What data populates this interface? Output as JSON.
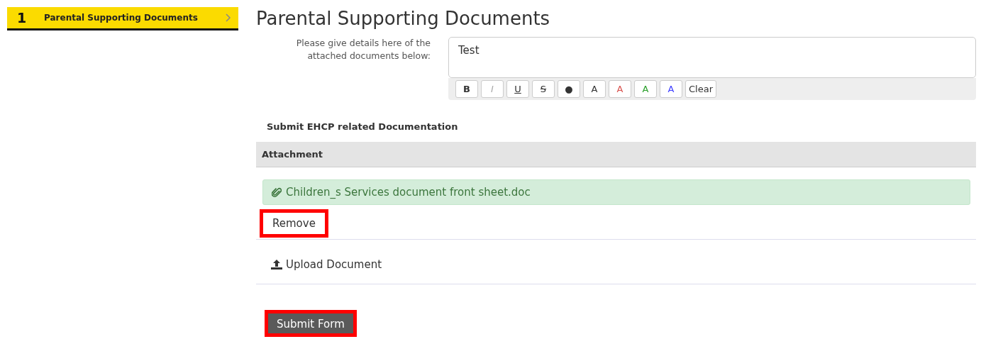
{
  "steps": [
    {
      "number": "1",
      "label": "Parental Supporting Documents",
      "selected": true
    }
  ],
  "heading": "Parental Supporting Documents",
  "details_field": {
    "label": "Please give details here of the attached documents below:",
    "value": "Test"
  },
  "toolbar": [
    {
      "label": "B",
      "kind": "bold"
    },
    {
      "label": "I",
      "kind": "italic"
    },
    {
      "label": "U",
      "kind": "underline"
    },
    {
      "label": "S",
      "kind": "strike"
    },
    {
      "label": "●",
      "kind": "plain"
    },
    {
      "label": "A",
      "kind": "color",
      "color": "#333333"
    },
    {
      "label": "A",
      "kind": "color",
      "color": "#d9534f"
    },
    {
      "label": "A",
      "kind": "color",
      "color": "#2ca02c"
    },
    {
      "label": "A",
      "kind": "color",
      "color": "#4040ff"
    },
    {
      "label": "Clear",
      "kind": "plain"
    }
  ],
  "section_title": "Submit EHCP related Documentation",
  "table": {
    "columns": [
      "Attachment"
    ],
    "attachments": [
      {
        "file": "Children_s Services document front sheet.doc"
      }
    ]
  },
  "remove_button": {
    "label": "Remove",
    "highlighted": true
  },
  "upload_button": {
    "label": "Upload Document"
  },
  "submit_button": {
    "label": "Submit Form",
    "highlighted": true
  }
}
